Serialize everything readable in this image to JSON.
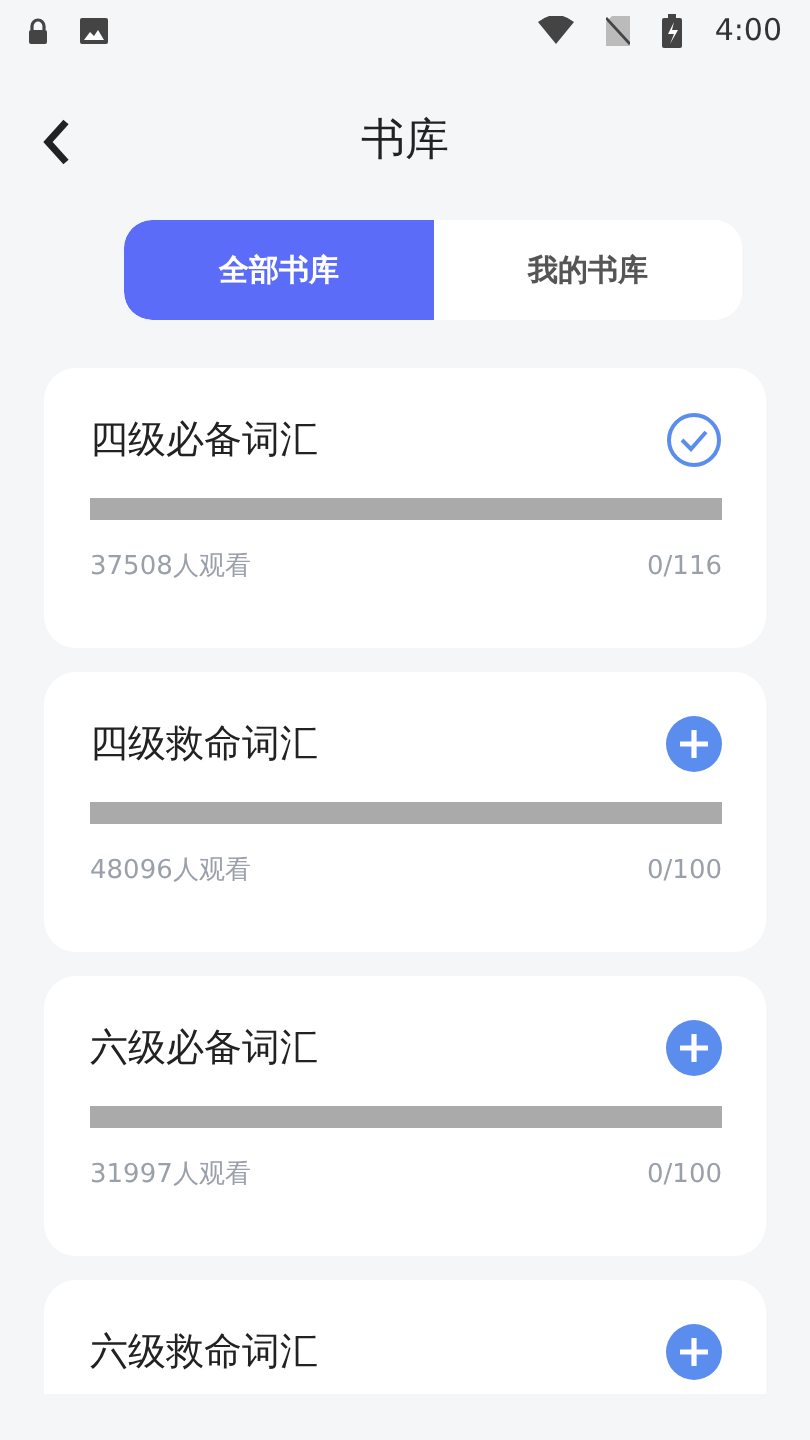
{
  "status_bar": {
    "time": "4:00"
  },
  "header": {
    "title": "书库"
  },
  "tabs": [
    {
      "label": "全部书库",
      "selected": true
    },
    {
      "label": "我的书库",
      "selected": false
    }
  ],
  "books": [
    {
      "title": "四级必备词汇",
      "added": true,
      "level": 0,
      "viewers": "37508人观看",
      "progress": "0/116"
    },
    {
      "title": "四级救命词汇",
      "added": false,
      "level": 0,
      "viewers": "48096人观看",
      "progress": "0/100"
    },
    {
      "title": "六级必备词汇",
      "added": false,
      "level": 0,
      "viewers": "31997人观看",
      "progress": "0/100"
    },
    {
      "title": "六级救命词汇",
      "added": false
    }
  ]
}
